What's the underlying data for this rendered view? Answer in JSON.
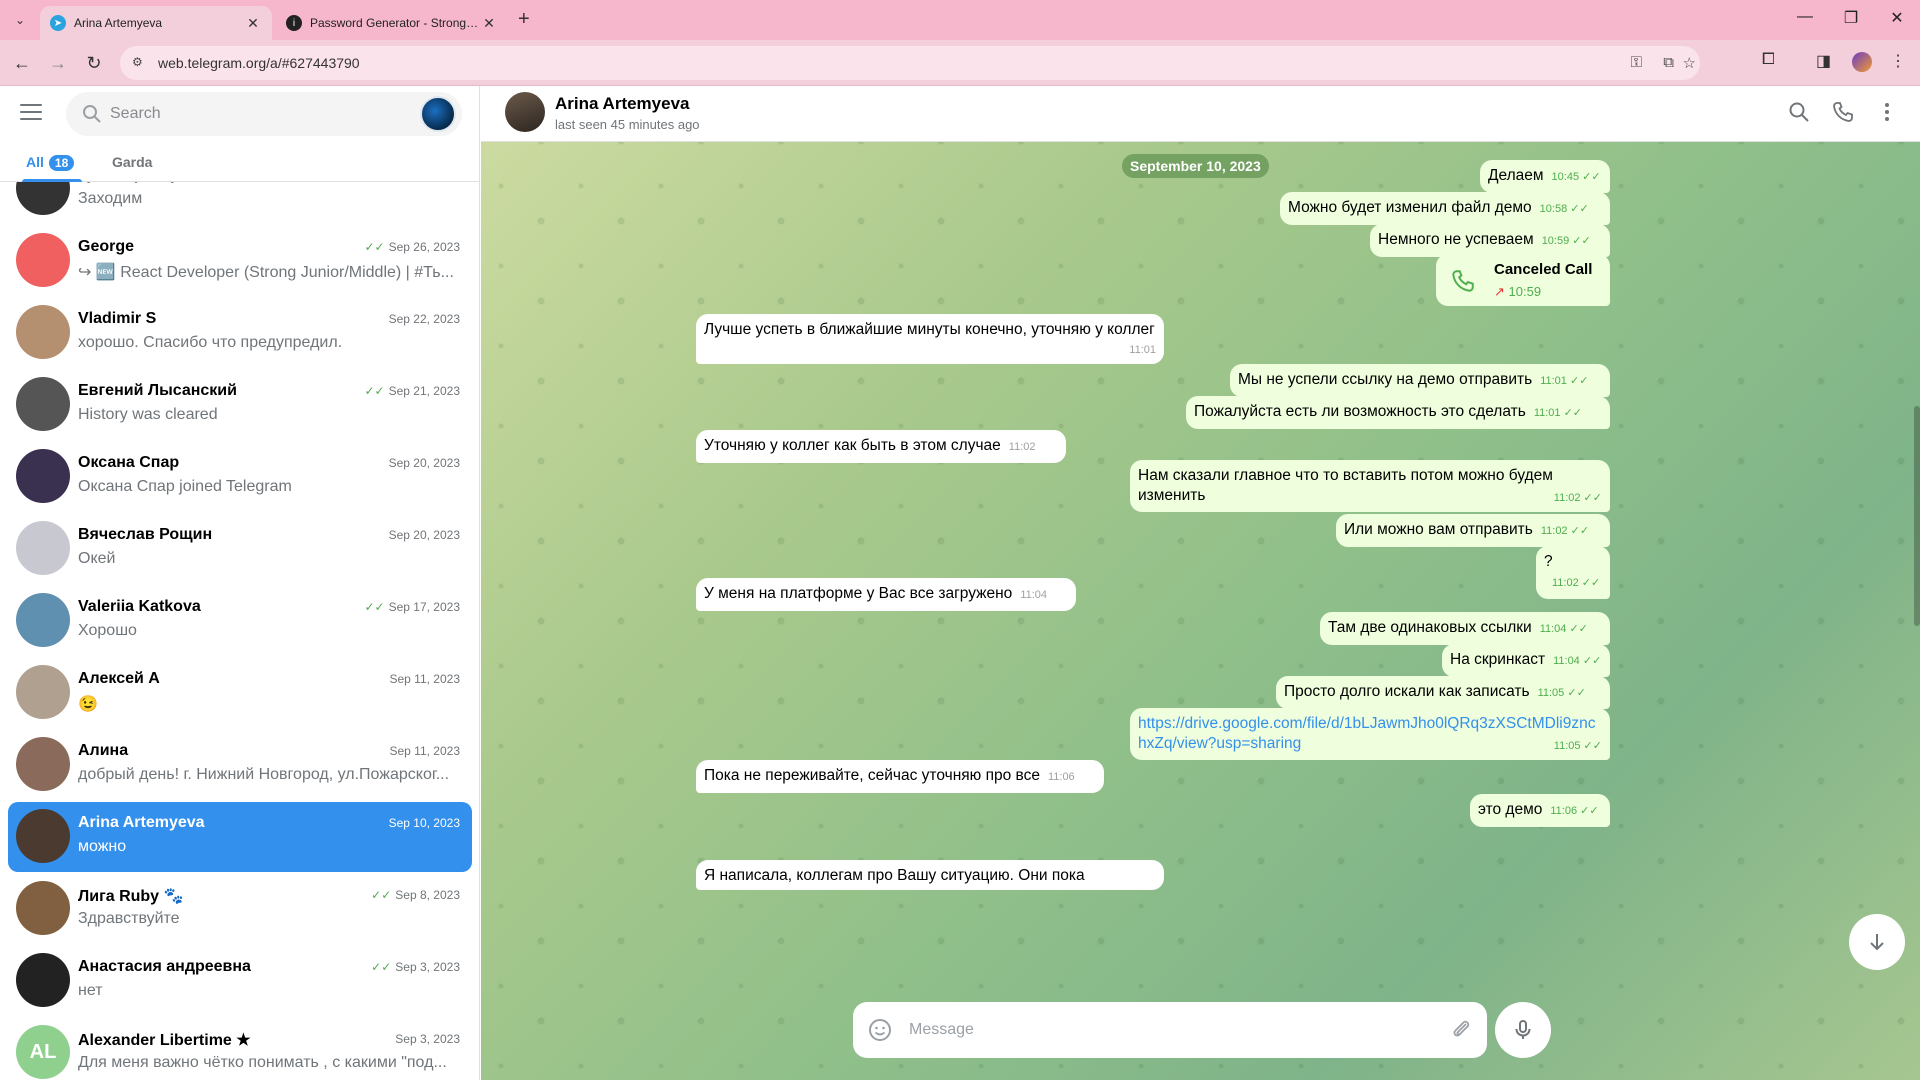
{
  "browser": {
    "tabs": [
      {
        "title": "Arina Artemyeva",
        "icon": "telegram-icon",
        "active": true
      },
      {
        "title": "Password Generator - Strong, R",
        "icon": "info-icon",
        "active": false
      }
    ],
    "url": "web.telegram.org/a/#627443790"
  },
  "sidebar": {
    "search_placeholder": "Search",
    "folders": [
      {
        "label": "All",
        "badge": "18"
      },
      {
        "label": "Garda"
      }
    ],
    "chats": [
      {
        "name": "Гульнара Мухаметова",
        "date": "",
        "preview": "Заходим",
        "read": false,
        "avatar_color": "#333"
      },
      {
        "name": "George",
        "date": "Sep 26, 2023",
        "preview": "↪ 🆕 React Developer (Strong Junior/Middle) | #Ть...",
        "read": true,
        "avatar_color": "#f06060"
      },
      {
        "name": "Vladimir S",
        "date": "Sep 22, 2023",
        "preview": "хорошо. Спасибо что предупредил.",
        "read": false,
        "avatar_color": "#b49070"
      },
      {
        "name": "Евгений Лысанский",
        "date": "Sep 21, 2023",
        "preview": "History was cleared",
        "read": true,
        "avatar_color": "#555"
      },
      {
        "name": "Оксана Спар",
        "date": "Sep 20, 2023",
        "preview": "Оксана Спар joined Telegram",
        "read": false,
        "avatar_color": "#3a3050"
      },
      {
        "name": "Вячеслав Рощин",
        "date": "Sep 20, 2023",
        "preview": "Окей",
        "read": false,
        "avatar_color": "#c8c8d0"
      },
      {
        "name": "Valeriia Katkova",
        "date": "Sep 17, 2023",
        "preview": "Хорошо",
        "read": true,
        "avatar_color": "#6090b0"
      },
      {
        "name": "Алексей А",
        "date": "Sep 11, 2023",
        "preview": "😉",
        "read": false,
        "avatar_color": "#b0a090"
      },
      {
        "name": "Алина",
        "date": "Sep 11, 2023",
        "preview": "добрый день! г. Нижний Новгород, ул.Пожарског...",
        "read": false,
        "avatar_color": "#8a6a5a"
      },
      {
        "name": "Arina Artemyeva",
        "date": "Sep 10, 2023",
        "preview": "можно",
        "read": false,
        "avatar_color": "#4a3a30",
        "active": true
      },
      {
        "name": "Лига Ruby 🐾",
        "date": "Sep 8, 2023",
        "preview": "Здравствуйте",
        "read": true,
        "avatar_color": "#806040"
      },
      {
        "name": "Анастасия андреевна",
        "date": "Sep 3, 2023",
        "preview": "нет",
        "read": true,
        "avatar_color": "#222"
      },
      {
        "name": "Alexander Libertime ★",
        "date": "Sep 3, 2023",
        "preview": "Для меня важно чётко понимать , с какими \"под...",
        "read": false,
        "avatar_color": "#8fd08f",
        "initials": "AL"
      }
    ]
  },
  "chat": {
    "name": "Arina Artemyeva",
    "status": "last seen 45 minutes ago",
    "date_chip": "September 10, 2023",
    "messages": [
      {
        "dir": "out",
        "text": "Делаем",
        "time": "10:45"
      },
      {
        "dir": "out",
        "text": "Можно будет изменил файл демо",
        "time": "10:58"
      },
      {
        "dir": "out",
        "text": "Немного не успеваем",
        "time": "10:59"
      },
      {
        "dir": "call",
        "text": "Canceled Call",
        "time": "10:59"
      },
      {
        "dir": "in",
        "text": "Лучше успеть в ближайшие минуты конечно, уточняю у коллег",
        "time": "11:01"
      },
      {
        "dir": "out",
        "text": "Мы не успели ссылку на демо отправить",
        "time": "11:01"
      },
      {
        "dir": "out",
        "text": "Пожалуйста есть ли возможность это сделать",
        "time": "11:01"
      },
      {
        "dir": "in",
        "text": "Уточняю у коллег как быть в этом случае",
        "time": "11:02"
      },
      {
        "dir": "out",
        "text": "Нам сказали главное что то вставить потом можно будем изменить",
        "time": "11:02"
      },
      {
        "dir": "out",
        "text": "Или можно вам отправить",
        "time": "11:02"
      },
      {
        "dir": "out",
        "text": "?",
        "time": "11:02"
      },
      {
        "dir": "in",
        "text": "У меня на платформе у Вас все загружено",
        "time": "11:04"
      },
      {
        "dir": "out",
        "text": "Там две одинаковых ссылки",
        "time": "11:04"
      },
      {
        "dir": "out",
        "text": "На скринкаст",
        "time": "11:04"
      },
      {
        "dir": "out",
        "text": "Просто долго искали как записать",
        "time": "11:05"
      },
      {
        "dir": "out",
        "text": "https://drive.google.com/file/d/1bLJawmJho0lQRq3zXSCtMDli9znchxZq/view?usp=sharing",
        "time": "11:05",
        "link": true
      },
      {
        "dir": "in",
        "text": "Пока не переживайте, сейчас уточняю про все",
        "time": "11:06"
      },
      {
        "dir": "out",
        "text": "это демо",
        "time": "11:06"
      },
      {
        "dir": "in",
        "text": "Я написала, коллегам про Вашу ситуацию. Они пока",
        "time": ""
      }
    ],
    "composer_placeholder": "Message"
  }
}
